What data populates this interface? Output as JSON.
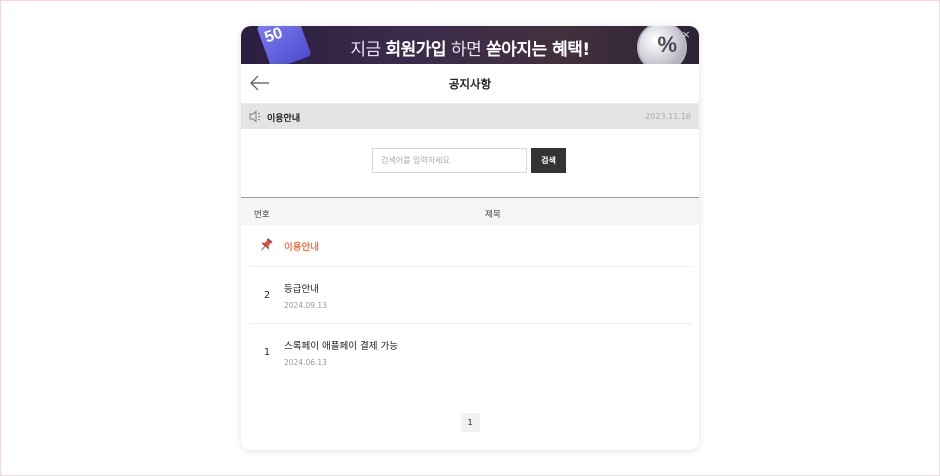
{
  "banner": {
    "badge_text": "50",
    "text_prefix": "지금 ",
    "text_bold1": "회원가입",
    "text_mid": " 하면 ",
    "text_bold2": "쏟아지는 혜택!",
    "coin_text": "%",
    "close_label": "×"
  },
  "header": {
    "back_icon": "arrow-left-icon",
    "title": "공지사항"
  },
  "notice": {
    "icon": "speaker-icon",
    "label": "이용안내",
    "date": "2023.11.16"
  },
  "search": {
    "placeholder": "검색어를 입력하세요",
    "value": "",
    "button_label": "검색"
  },
  "table": {
    "headers": {
      "number": "번호",
      "title": "제목"
    },
    "pinned": {
      "icon": "pushpin-icon",
      "title": "이용안내",
      "color": "#e87a4f"
    },
    "rows": [
      {
        "number": "2",
        "title": "등급안내",
        "date": "2024.09.13"
      },
      {
        "number": "1",
        "title": "스록페이 애플페이 결제 가능",
        "date": "2024.06.13"
      }
    ]
  },
  "pagination": {
    "pages": [
      "1"
    ],
    "current": "1"
  }
}
